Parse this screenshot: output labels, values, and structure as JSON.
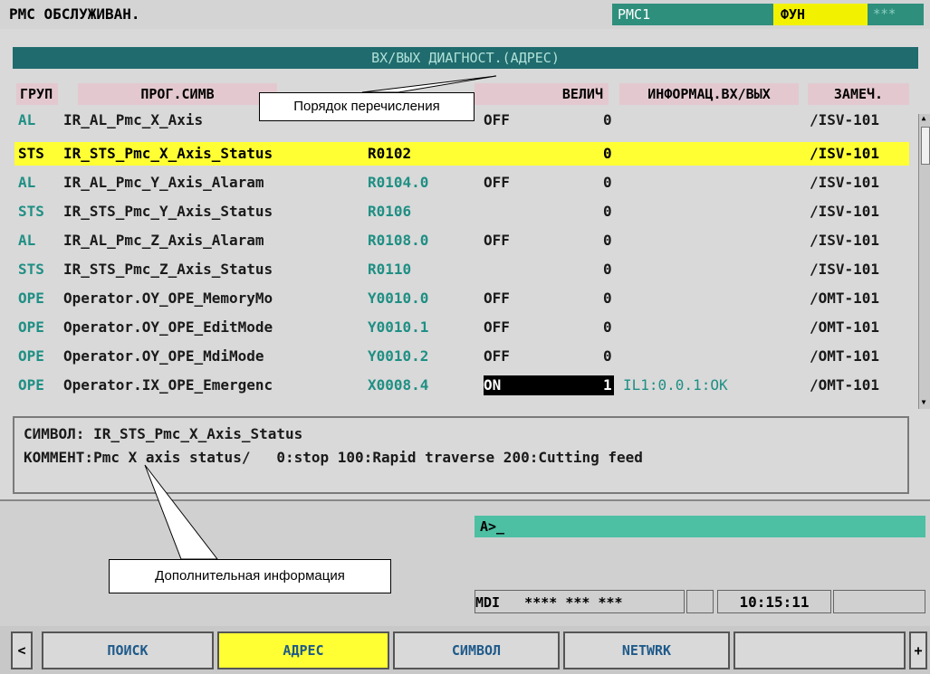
{
  "topbar": {
    "title": "РМС ОБСЛУЖИВАН.",
    "pmc": "PMC1",
    "fn": "ФУН",
    "stars": "***"
  },
  "screen_title": "ВХ/ВЫХ ДИАГНОСТ.(АДРЕС)",
  "headers": {
    "group": "ГРУП",
    "prog_symbol": "ПРОГ.СИМВ",
    "value": "ВЕЛИЧ",
    "io_info": "ИНФОРМАЦ.ВХ/ВЫХ",
    "note": "ЗАМЕЧ."
  },
  "rows": [
    {
      "group": "AL",
      "symbol": "IR_AL_Pmc_X_Axis",
      "address": "",
      "onoff": "OFF",
      "num": "0",
      "info": "",
      "note": "/ISV-101",
      "selected": false
    },
    {
      "group": "STS",
      "symbol": "IR_STS_Pmc_X_Axis_Status",
      "address": "R0102",
      "onoff": "",
      "num": "0",
      "info": "",
      "note": "/ISV-101",
      "selected": true
    },
    {
      "group": "AL",
      "symbol": "IR_AL_Pmc_Y_Axis_Alaram",
      "address": "R0104.0",
      "onoff": "OFF",
      "num": "0",
      "info": "",
      "note": "/ISV-101",
      "selected": false
    },
    {
      "group": "STS",
      "symbol": "IR_STS_Pmc_Y_Axis_Status",
      "address": "R0106",
      "onoff": "",
      "num": "0",
      "info": "",
      "note": "/ISV-101",
      "selected": false
    },
    {
      "group": "AL",
      "symbol": "IR_AL_Pmc_Z_Axis_Alaram",
      "address": "R0108.0",
      "onoff": "OFF",
      "num": "0",
      "info": "",
      "note": "/ISV-101",
      "selected": false
    },
    {
      "group": "STS",
      "symbol": "IR_STS_Pmc_Z_Axis_Status",
      "address": "R0110",
      "onoff": "",
      "num": "0",
      "info": "",
      "note": "/ISV-101",
      "selected": false
    },
    {
      "group": "OPE",
      "symbol": "Operator.OY_OPE_MemoryMo",
      "address": "Y0010.0",
      "onoff": "OFF",
      "num": "0",
      "info": "",
      "note": "/OMT-101",
      "selected": false
    },
    {
      "group": "OPE",
      "symbol": "Operator.OY_OPE_EditMode",
      "address": "Y0010.1",
      "onoff": "OFF",
      "num": "0",
      "info": "",
      "note": "/OMT-101",
      "selected": false
    },
    {
      "group": "OPE",
      "symbol": "Operator.OY_OPE_MdiMode",
      "address": "Y0010.2",
      "onoff": "OFF",
      "num": "0",
      "info": "",
      "note": "/OMT-101",
      "selected": false
    },
    {
      "group": "OPE",
      "symbol": "Operator.IX_OPE_Emergenc",
      "address": "X0008.4",
      "onoff": "ON",
      "num": "1",
      "info": "IL1:0.0.1:OK",
      "note": "/OMT-101",
      "selected": false
    }
  ],
  "info_box": {
    "symbol_line": "СИМВОЛ: IR_STS_Pmc_X_Axis_Status",
    "comment_line": "КОММЕНТ:Pmc X axis status/   0:stop 100:Rapid traverse 200:Cutting feed"
  },
  "prompt": "A>_",
  "status": {
    "mode": "MDI   **** *** ***",
    "clock": "10:15:11"
  },
  "softkeys": {
    "left_arrow": "<",
    "search": "ПОИСК",
    "address": "АДРЕС",
    "symbol": "СИМВОЛ",
    "network": "NETWRK",
    "blank": "",
    "right_plus": "+"
  },
  "callouts": {
    "order": "Порядок перечисления",
    "extra_info": "Дополнительная информация"
  },
  "colors": {
    "teal_dark": "#1f6b6e",
    "teal_text": "#1f8f84",
    "highlight_yellow": "#ffff33",
    "prompt_green": "#4dbfa3"
  }
}
